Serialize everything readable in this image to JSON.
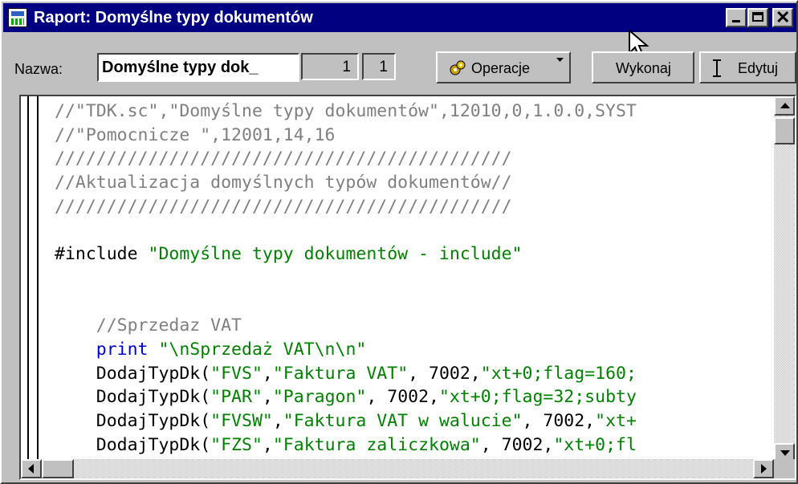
{
  "window": {
    "title": "Raport: Domyślne typy dokumentów",
    "icon": "report-icon",
    "controls": [
      "minimize-icon",
      "maximize-icon",
      "close-icon"
    ],
    "close_glyph": "✕"
  },
  "toolbar": {
    "name_label": "Nazwa:",
    "name_value": "Domyślne typy dok_",
    "counter_1": "1",
    "counter_2": "1",
    "operacje_label": "Operacje",
    "wykonaj_label": "Wykonaj",
    "edytuj_label": "Edytuj"
  },
  "editor": {
    "lines": [
      [
        {
          "t": "//\"TDK.sc\",\"Domyślne typy dokumentów\",12010,0,1.0.0,SYST",
          "c": "com"
        }
      ],
      [
        {
          "t": "//\"Pomocnicze \",12001,14,16",
          "c": "com"
        }
      ],
      [
        {
          "t": "////////////////////////////////////////////",
          "c": "com"
        }
      ],
      [
        {
          "t": "//Aktualizacja domyślnych typów dokumentów//",
          "c": "com"
        }
      ],
      [
        {
          "t": "////////////////////////////////////////////",
          "c": "com"
        }
      ],
      [
        {
          "t": "",
          "c": ""
        }
      ],
      [
        {
          "t": "#include ",
          "c": ""
        },
        {
          "t": "\"Domyślne typy dokumentów - include\"",
          "c": "str"
        }
      ],
      [
        {
          "t": "",
          "c": ""
        }
      ],
      [
        {
          "t": "",
          "c": ""
        }
      ],
      [
        {
          "t": "    //Sprzedaz VAT",
          "c": "com"
        }
      ],
      [
        {
          "t": "    print ",
          "c": "kw"
        },
        {
          "t": "\"\\nSprzedaż VAT\\n\\n\"",
          "c": "str"
        }
      ],
      [
        {
          "t": "    DodajTypDk(",
          "c": ""
        },
        {
          "t": "\"FVS\"",
          "c": "str"
        },
        {
          "t": ",",
          "c": ""
        },
        {
          "t": "\"Faktura VAT\"",
          "c": "str"
        },
        {
          "t": ", 7002,",
          "c": ""
        },
        {
          "t": "\"xt+0;flag=160;",
          "c": "str"
        }
      ],
      [
        {
          "t": "    DodajTypDk(",
          "c": ""
        },
        {
          "t": "\"PAR\"",
          "c": "str"
        },
        {
          "t": ",",
          "c": ""
        },
        {
          "t": "\"Paragon\"",
          "c": "str"
        },
        {
          "t": ", 7002,",
          "c": ""
        },
        {
          "t": "\"xt+0;flag=32;subty",
          "c": "str"
        }
      ],
      [
        {
          "t": "    DodajTypDk(",
          "c": ""
        },
        {
          "t": "\"FVSW\"",
          "c": "str"
        },
        {
          "t": ",",
          "c": ""
        },
        {
          "t": "\"Faktura VAT w walucie\"",
          "c": "str"
        },
        {
          "t": ", 7002,",
          "c": ""
        },
        {
          "t": "\"xt+",
          "c": "str"
        }
      ],
      [
        {
          "t": "    DodajTypDk(",
          "c": ""
        },
        {
          "t": "\"FZS\"",
          "c": "str"
        },
        {
          "t": ",",
          "c": ""
        },
        {
          "t": "\"Faktura zaliczkowa\"",
          "c": "str"
        },
        {
          "t": ", 7002,",
          "c": ""
        },
        {
          "t": "\"xt+0;fl",
          "c": "str"
        }
      ]
    ]
  },
  "colors": {
    "title_bar": "#000080",
    "comment": "#808080",
    "string": "#008000",
    "keyword": "#0000cc"
  }
}
